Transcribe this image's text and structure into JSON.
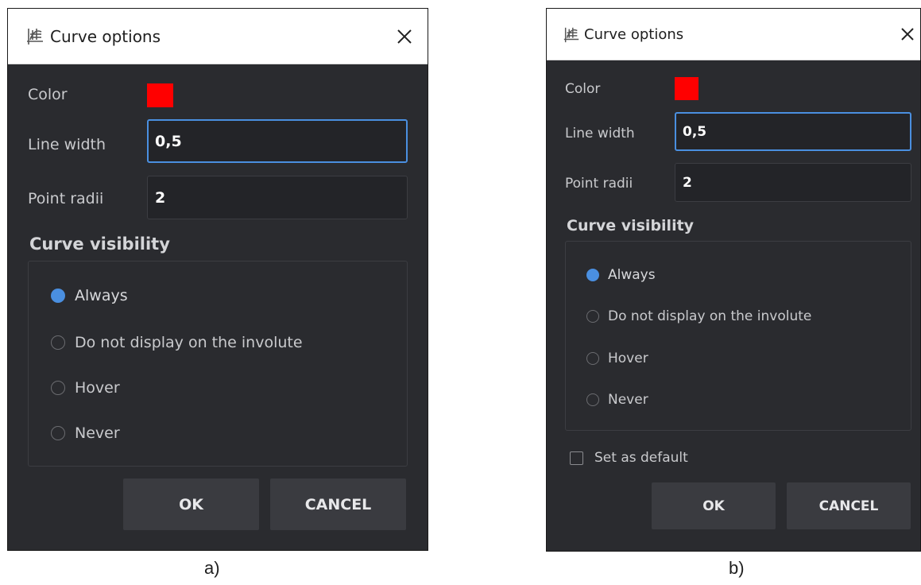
{
  "dialog_a": {
    "title": "Curve options",
    "color_label": "Color",
    "color_value": "#ff0000",
    "line_width_label": "Line width",
    "line_width_value": "0,5",
    "point_radii_label": "Point radii",
    "point_radii_value": "2",
    "visibility_title": "Curve visibility",
    "options": [
      "Always",
      "Do not display on the involute",
      "Hover",
      "Never"
    ],
    "selected_option": "Always",
    "ok_label": "OK",
    "cancel_label": "CANCEL"
  },
  "dialog_b": {
    "title": "Curve options",
    "color_label": "Color",
    "color_value": "#ff0000",
    "line_width_label": "Line width",
    "line_width_value": "0,5",
    "point_radii_label": "Point radii",
    "point_radii_value": "2",
    "visibility_title": "Curve visibility",
    "options": [
      "Always",
      "Do not display on the involute",
      "Hover",
      "Never"
    ],
    "selected_option": "Always",
    "default_label": "Set as default",
    "default_checked": false,
    "ok_label": "OK",
    "cancel_label": "CANCEL"
  },
  "captions": {
    "a": "a)",
    "b": "b)"
  },
  "theme": {
    "accent": "#4a8fe0",
    "background": "#2a2b2f"
  }
}
